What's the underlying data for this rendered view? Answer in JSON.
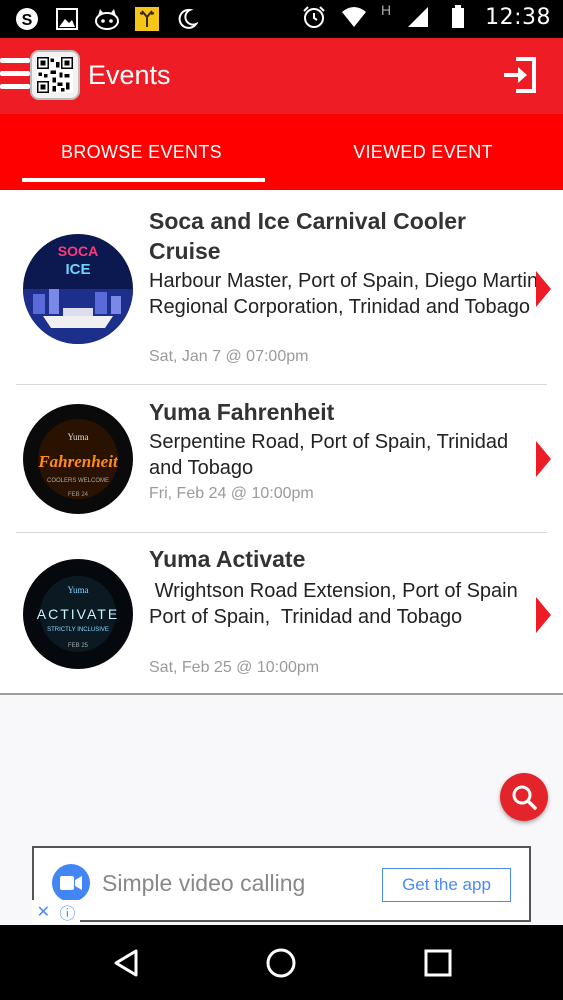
{
  "status_bar": {
    "time": "12:38",
    "network_badge": "H",
    "left_icons": [
      "skype-icon",
      "image-icon",
      "cat-icon",
      "deer-app-icon",
      "moon-icon"
    ],
    "right_icons": [
      "alarm-icon",
      "wifi-icon",
      "signal-icon",
      "battery-icon"
    ]
  },
  "app_bar": {
    "title": "Events",
    "menu_icon": "hamburger-icon",
    "logo": "qr-code-logo",
    "action_icon": "login-icon"
  },
  "tabs": [
    {
      "label": "BROWSE EVENTS",
      "selected": true
    },
    {
      "label": "VIEWED EVENT",
      "selected": false
    }
  ],
  "events": [
    {
      "title": "Soca and Ice Carnival Cooler Cruise",
      "venue": "Harbour Master, Port of Spain, Diego Martin Regional Corporation, Trinidad and Tobago",
      "date": "Sat, Jan 7 @ 07:00pm",
      "image_text": "SOCA ICE"
    },
    {
      "title": "Yuma Fahrenheit",
      "venue": "Serpentine Road, Port of Spain, Trinidad and Tobago",
      "date": "Fri, Feb 24 @ 10:00pm",
      "image_text": "Fahrenheit"
    },
    {
      "title": "Yuma Activate",
      "venue": " Wrightson Road Extension, Port of Spain Port of Spain,  Trinidad and Tobago",
      "date": "Sat, Feb 25 @ 10:00pm",
      "image_text": "ACTIVATE"
    }
  ],
  "fab": {
    "icon": "search-icon"
  },
  "ad": {
    "text": "Simple video calling",
    "button": "Get the app",
    "logo": "duo-video-icon"
  },
  "nav_bar": {
    "icons": [
      "back-icon",
      "home-icon",
      "recents-icon"
    ]
  },
  "colors": {
    "primary": "#ee1c25",
    "tab_bar": "#fe0000",
    "accent_fab": "#e3252b",
    "date_text": "#9a9a9a"
  }
}
